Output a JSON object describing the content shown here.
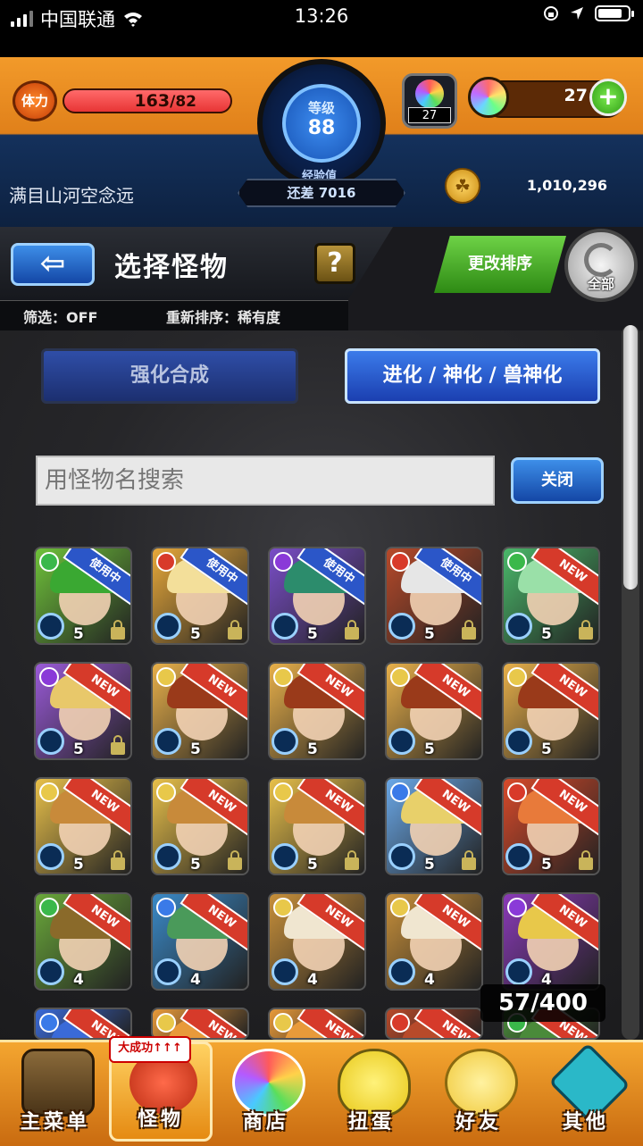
{
  "status_bar": {
    "carrier": "中国联通",
    "time": "13:26"
  },
  "header": {
    "stamina_label": "体力",
    "stamina_current": "163",
    "stamina_max": "/82",
    "stamina_fill_fraction": 1.0,
    "rank_label": "等级",
    "rank_value": "88",
    "exp_label": "经验值",
    "exp_remaining": "还差 7016",
    "gem_count": "27",
    "orb_count": "27",
    "plus_icon": "+",
    "username": "满目山河空念远",
    "coin_symbol": "☘",
    "coins": "1,010,296"
  },
  "panel": {
    "back_icon": "⇦",
    "title": "选择怪物",
    "help_icon": "?",
    "filter": "筛选：OFF",
    "sort": "重新排序：稀有度",
    "sort_button": "更改排序",
    "all_button": "全部"
  },
  "tabs": {
    "enhance": "强化合成",
    "evolve": "进化 / 神化 / 兽神化"
  },
  "search": {
    "placeholder": "用怪物名搜索",
    "close": "关闭"
  },
  "badges": {
    "new": "NEW",
    "in_use": "使用中"
  },
  "monsters": [
    {
      "badge": "in_use",
      "rarity": "5",
      "locked": true,
      "color": "#6fc23a",
      "hair": "#3aa832",
      "elem": "#3ab84a"
    },
    {
      "badge": "in_use",
      "rarity": "5",
      "locked": true,
      "color": "#e8a93a",
      "hair": "#f3df9a",
      "elem": "#d83a2a"
    },
    {
      "badge": "in_use",
      "rarity": "5",
      "locked": true,
      "color": "#7a4ec8",
      "hair": "#2c8c6c",
      "elem": "#8a3ad8"
    },
    {
      "badge": "in_use",
      "rarity": "5",
      "locked": true,
      "color": "#b84a2a",
      "hair": "#e6e6e6",
      "elem": "#d83a2a"
    },
    {
      "badge": "new",
      "rarity": "5",
      "locked": true,
      "color": "#4ab86a",
      "hair": "#9ae0a8",
      "elem": "#3ab84a"
    },
    {
      "badge": "new",
      "rarity": "5",
      "locked": true,
      "color": "#9a5ad8",
      "hair": "#e8c86a",
      "elem": "#8a3ad8"
    },
    {
      "badge": "new",
      "rarity": "5",
      "locked": false,
      "color": "#e8b04a",
      "hair": "#9a3a1a",
      "elem": "#e8c84a"
    },
    {
      "badge": "new",
      "rarity": "5",
      "locked": false,
      "color": "#e8b04a",
      "hair": "#9a3a1a",
      "elem": "#e8c84a"
    },
    {
      "badge": "new",
      "rarity": "5",
      "locked": false,
      "color": "#e8b04a",
      "hair": "#9a3a1a",
      "elem": "#e8c84a"
    },
    {
      "badge": "new",
      "rarity": "5",
      "locked": false,
      "color": "#e8b04a",
      "hair": "#9a3a1a",
      "elem": "#e8c84a"
    },
    {
      "badge": "new",
      "rarity": "5",
      "locked": true,
      "color": "#e8c04a",
      "hair": "#c88a3a",
      "elem": "#e8c84a"
    },
    {
      "badge": "new",
      "rarity": "5",
      "locked": true,
      "color": "#e8c04a",
      "hair": "#c88a3a",
      "elem": "#e8c84a"
    },
    {
      "badge": "new",
      "rarity": "5",
      "locked": true,
      "color": "#e8c04a",
      "hair": "#c88a3a",
      "elem": "#e8c84a"
    },
    {
      "badge": "new",
      "rarity": "5",
      "locked": true,
      "color": "#6aa8e8",
      "hair": "#e8d06a",
      "elem": "#3a7ae8"
    },
    {
      "badge": "new",
      "rarity": "5",
      "locked": true,
      "color": "#d84a2a",
      "hair": "#e87a3a",
      "elem": "#d83a2a"
    },
    {
      "badge": "new",
      "rarity": "4",
      "locked": false,
      "color": "#6aa83a",
      "hair": "#8a6a2a",
      "elem": "#3ab84a"
    },
    {
      "badge": "new",
      "rarity": "4",
      "locked": false,
      "color": "#3a8ac8",
      "hair": "#4a9a5a",
      "elem": "#3a7ae8"
    },
    {
      "badge": "new",
      "rarity": "4",
      "locked": false,
      "color": "#c8903a",
      "hair": "#f0e6d0",
      "elem": "#e8c84a"
    },
    {
      "badge": "new",
      "rarity": "4",
      "locked": false,
      "color": "#c8903a",
      "hair": "#f0e6d0",
      "elem": "#e8c84a"
    },
    {
      "badge": "new",
      "rarity": "4",
      "locked": false,
      "color": "#8a3ab8",
      "hair": "#e8c84a",
      "elem": "#8a3ad8"
    },
    {
      "badge": "new",
      "rarity": "",
      "locked": false,
      "color": "#3a6ad8",
      "hair": "#3a6ad8",
      "elem": "#3a7ae8"
    },
    {
      "badge": "new",
      "rarity": "",
      "locked": false,
      "color": "#e89a3a",
      "hair": "#e89a3a",
      "elem": "#e8c84a"
    },
    {
      "badge": "new",
      "rarity": "",
      "locked": false,
      "color": "#e89a3a",
      "hair": "#e89a3a",
      "elem": "#e8c84a"
    },
    {
      "badge": "new",
      "rarity": "",
      "locked": false,
      "color": "#b84a2a",
      "hair": "#b84a2a",
      "elem": "#d83a2a"
    },
    {
      "badge": "new",
      "rarity": "",
      "locked": false,
      "color": "#4a8a3a",
      "hair": "#4a8a3a",
      "elem": "#3ab84a"
    }
  ],
  "box_count": "57/400",
  "nav": {
    "home": "主菜单",
    "monster": "怪物",
    "monster_tag": "大成功↑↑↑",
    "shop": "商店",
    "gacha": "扭蛋",
    "friends": "好友",
    "other": "其他"
  }
}
